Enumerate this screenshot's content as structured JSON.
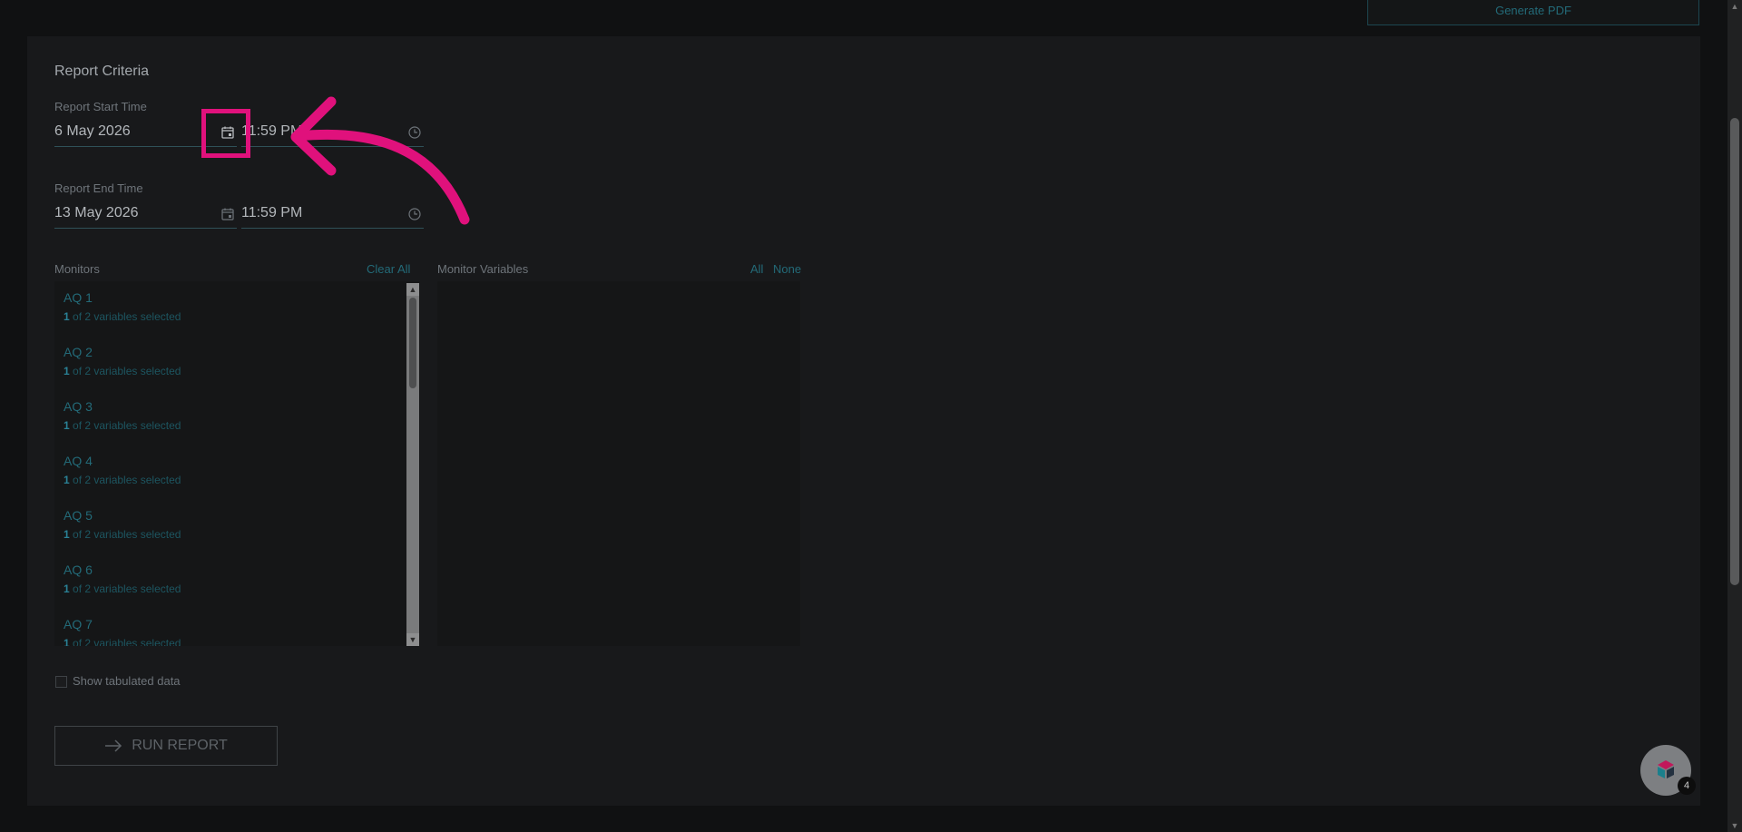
{
  "header": {
    "generate_pdf_label": "Generate PDF"
  },
  "report_criteria": {
    "title": "Report Criteria",
    "start": {
      "label": "Report Start Time",
      "date": "6 May 2026",
      "time": "11:59 PM"
    },
    "end": {
      "label": "Report End Time",
      "date": "13 May 2026",
      "time": "11:59 PM"
    }
  },
  "monitors": {
    "label": "Monitors",
    "clear_all": "Clear All",
    "items": [
      {
        "name": "AQ 1",
        "count": "1",
        "suffix": " of 2 variables selected"
      },
      {
        "name": "AQ 2",
        "count": "1",
        "suffix": " of 2 variables selected"
      },
      {
        "name": "AQ 3",
        "count": "1",
        "suffix": " of 2 variables selected"
      },
      {
        "name": "AQ 4",
        "count": "1",
        "suffix": " of 2 variables selected"
      },
      {
        "name": "AQ 5",
        "count": "1",
        "suffix": " of 2 variables selected"
      },
      {
        "name": "AQ 6",
        "count": "1",
        "suffix": " of 2 variables selected"
      },
      {
        "name": "AQ 7",
        "count": "1",
        "suffix": " of 2 variables selected"
      }
    ]
  },
  "monitor_variables": {
    "label": "Monitor Variables",
    "all": "All",
    "none": "None"
  },
  "options": {
    "show_tabulated": "Show tabulated data"
  },
  "run_report": {
    "label": "RUN REPORT"
  },
  "assistant": {
    "badge": "4"
  },
  "colors": {
    "highlight": "#e0117c",
    "accent": "#236a78",
    "panel": "#18191b"
  }
}
